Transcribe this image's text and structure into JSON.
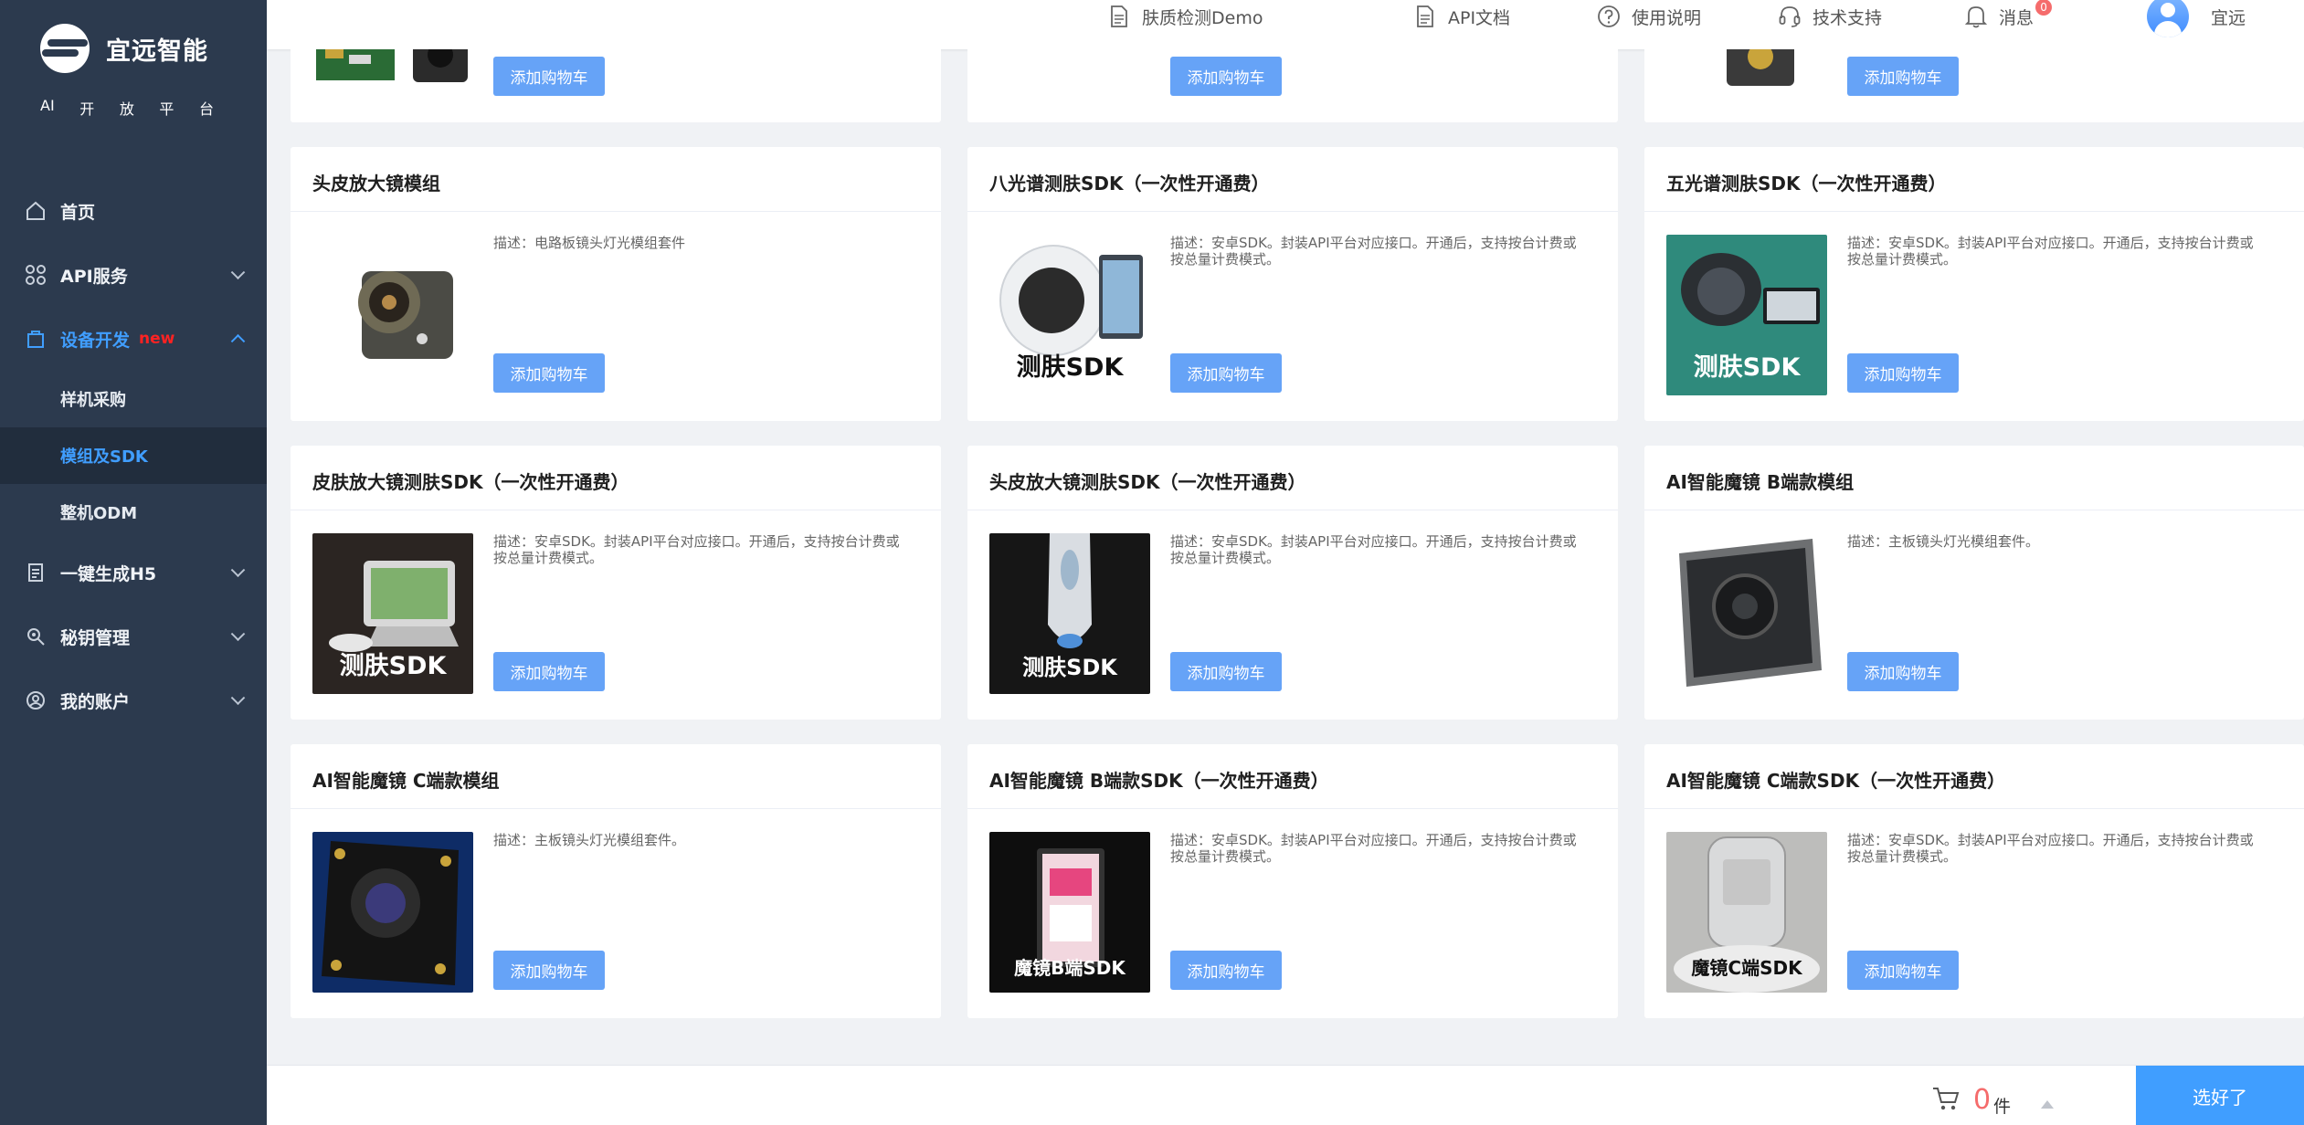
{
  "brand": {
    "name": "宜远智能",
    "platform_chars": [
      "AI",
      "开",
      "放",
      "平",
      "台"
    ]
  },
  "sidebar": {
    "items": [
      {
        "label": "首页",
        "icon": "home-icon"
      },
      {
        "label": "API服务",
        "icon": "grid-icon"
      },
      {
        "label": "设备开发",
        "badge": "new",
        "icon": "bag-icon"
      },
      {
        "label": "一键生成H5",
        "icon": "doc-icon"
      },
      {
        "label": "秘钥管理",
        "icon": "key-icon"
      },
      {
        "label": "我的账户",
        "icon": "user-icon"
      }
    ],
    "subitems": [
      {
        "label": "样机采购"
      },
      {
        "label": "模组及SDK"
      },
      {
        "label": "整机ODM"
      }
    ]
  },
  "topbar": {
    "demo": "肤质检测Demo",
    "api_doc": "API文档",
    "usage": "使用说明",
    "support": "技术支持",
    "messages": "消息",
    "messages_count": "0",
    "user": "宜远"
  },
  "cards": {
    "add_label": "添加购物车",
    "items": [
      {
        "title": "",
        "desc": "",
        "thumb_label": ""
      },
      {
        "title": "",
        "desc": "",
        "thumb_label": ""
      },
      {
        "title": "",
        "desc": "",
        "thumb_label": ""
      },
      {
        "title": "头皮放大镜模组",
        "desc": "描述：电路板镜头灯光模组套件",
        "thumb_label": ""
      },
      {
        "title": "八光谱测肤SDK（一次性开通费）",
        "desc": "描述：安卓SDK。封装API平台对应接口。开通后，支持按台计费或按总量计费模式。",
        "thumb_label": "测肤SDK"
      },
      {
        "title": "五光谱测肤SDK（一次性开通费）",
        "desc": "描述：安卓SDK。封装API平台对应接口。开通后，支持按台计费或按总量计费模式。",
        "thumb_label": "测肤SDK"
      },
      {
        "title": "皮肤放大镜测肤SDK（一次性开通费）",
        "desc": "描述：安卓SDK。封装API平台对应接口。开通后，支持按台计费或按总量计费模式。",
        "thumb_label": "测肤SDK"
      },
      {
        "title": "头皮放大镜测肤SDK（一次性开通费）",
        "desc": "描述：安卓SDK。封装API平台对应接口。开通后，支持按台计费或按总量计费模式。",
        "thumb_label": "测肤SDK"
      },
      {
        "title": "AI智能魔镜 B端款模组",
        "desc": "描述：主板镜头灯光模组套件。",
        "thumb_label": ""
      },
      {
        "title": "AI智能魔镜 C端款模组",
        "desc": "描述：主板镜头灯光模组套件。",
        "thumb_label": ""
      },
      {
        "title": "AI智能魔镜 B端款SDK（一次性开通费）",
        "desc": "描述：安卓SDK。封装API平台对应接口。开通后，支持按台计费或按总量计费模式。",
        "thumb_label": "魔镜B端SDK"
      },
      {
        "title": "AI智能魔镜 C端款SDK（一次性开通费）",
        "desc": "描述：安卓SDK。封装API平台对应接口。开通后，支持按台计费或按总量计费模式。",
        "thumb_label": "魔镜C端SDK"
      }
    ]
  },
  "bottombar": {
    "count": "0",
    "unit": "件",
    "confirm": "选好了"
  }
}
